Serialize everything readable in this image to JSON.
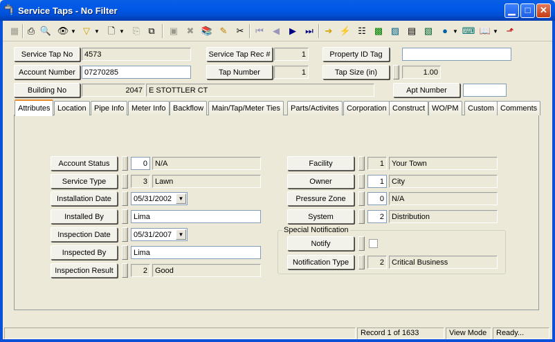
{
  "window": {
    "title": "Service Taps - No Filter"
  },
  "toolbar": {
    "icons": [
      "grid-icon",
      "print-icon",
      "print-preview-icon",
      "binoculars-icon",
      "filter-icon",
      "record-icon",
      "copy-icon",
      "paste-icon",
      "disk-icon",
      "delete-icon",
      "books-icon",
      "pencil-icon",
      "scissors-icon",
      "first-icon",
      "prev-icon",
      "next-icon",
      "last-icon",
      "arrow-right-icon",
      "lightning-icon",
      "hierarchy-icon",
      "map-icon",
      "calculator-icon",
      "globe-map-icon",
      "globe-icon",
      "keyboard-icon",
      "book-icon",
      "exit-icon"
    ]
  },
  "header": {
    "service_tap_no": {
      "label": "Service Tap No",
      "value": "4573"
    },
    "service_tap_rec": {
      "label": "Service Tap Rec #",
      "value": "1"
    },
    "property_id_tag": {
      "label": "Property ID Tag",
      "value": ""
    },
    "account_number": {
      "label": "Account Number",
      "value": "07270285"
    },
    "tap_number": {
      "label": "Tap Number",
      "value": "1"
    },
    "tap_size": {
      "label": "Tap Size (in)",
      "value": "1.00"
    },
    "building_no": {
      "label": "Building No",
      "number": "2047",
      "street": "E STOTTLER CT"
    },
    "apt_number": {
      "label": "Apt Number",
      "value": ""
    }
  },
  "tabs": [
    "Attributes",
    "Location",
    "Pipe Info",
    "Meter Info",
    "Backflow",
    "Main/Tap/Meter Ties",
    "Parts/Activites",
    "Corporation",
    "Construct",
    "WO/PM",
    "Custom",
    "Comments"
  ],
  "active_tab": "Attributes",
  "left": {
    "account_status": {
      "label": "Account Status",
      "code": "0",
      "value": "N/A"
    },
    "service_type": {
      "label": "Service Type",
      "code": "3",
      "value": "Lawn"
    },
    "installation_date": {
      "label": "Installation Date",
      "value": "05/31/2002"
    },
    "installed_by": {
      "label": "Installed By",
      "value": "Lima"
    },
    "inspection_date": {
      "label": "Inspection Date",
      "value": "05/31/2007"
    },
    "inspected_by": {
      "label": "Inspected By",
      "value": "Lima"
    },
    "inspection_result": {
      "label": "Inspection Result",
      "code": "2",
      "value": "Good"
    }
  },
  "right": {
    "facility": {
      "label": "Facility",
      "code": "1",
      "value": "Your Town"
    },
    "owner": {
      "label": "Owner",
      "code": "1",
      "value": "City"
    },
    "pressure_zone": {
      "label": "Pressure Zone",
      "code": "0",
      "value": "N/A"
    },
    "system": {
      "label": "System",
      "code": "2",
      "value": "Distribution"
    }
  },
  "special_notification": {
    "group_label": "Special Notification",
    "notify": {
      "label": "Notify",
      "checked": false
    },
    "notification_type": {
      "label": "Notification Type",
      "code": "2",
      "value": "Critical Business"
    }
  },
  "status": {
    "record": "Record 1 of 1633",
    "mode": "View Mode",
    "state": "Ready..."
  }
}
